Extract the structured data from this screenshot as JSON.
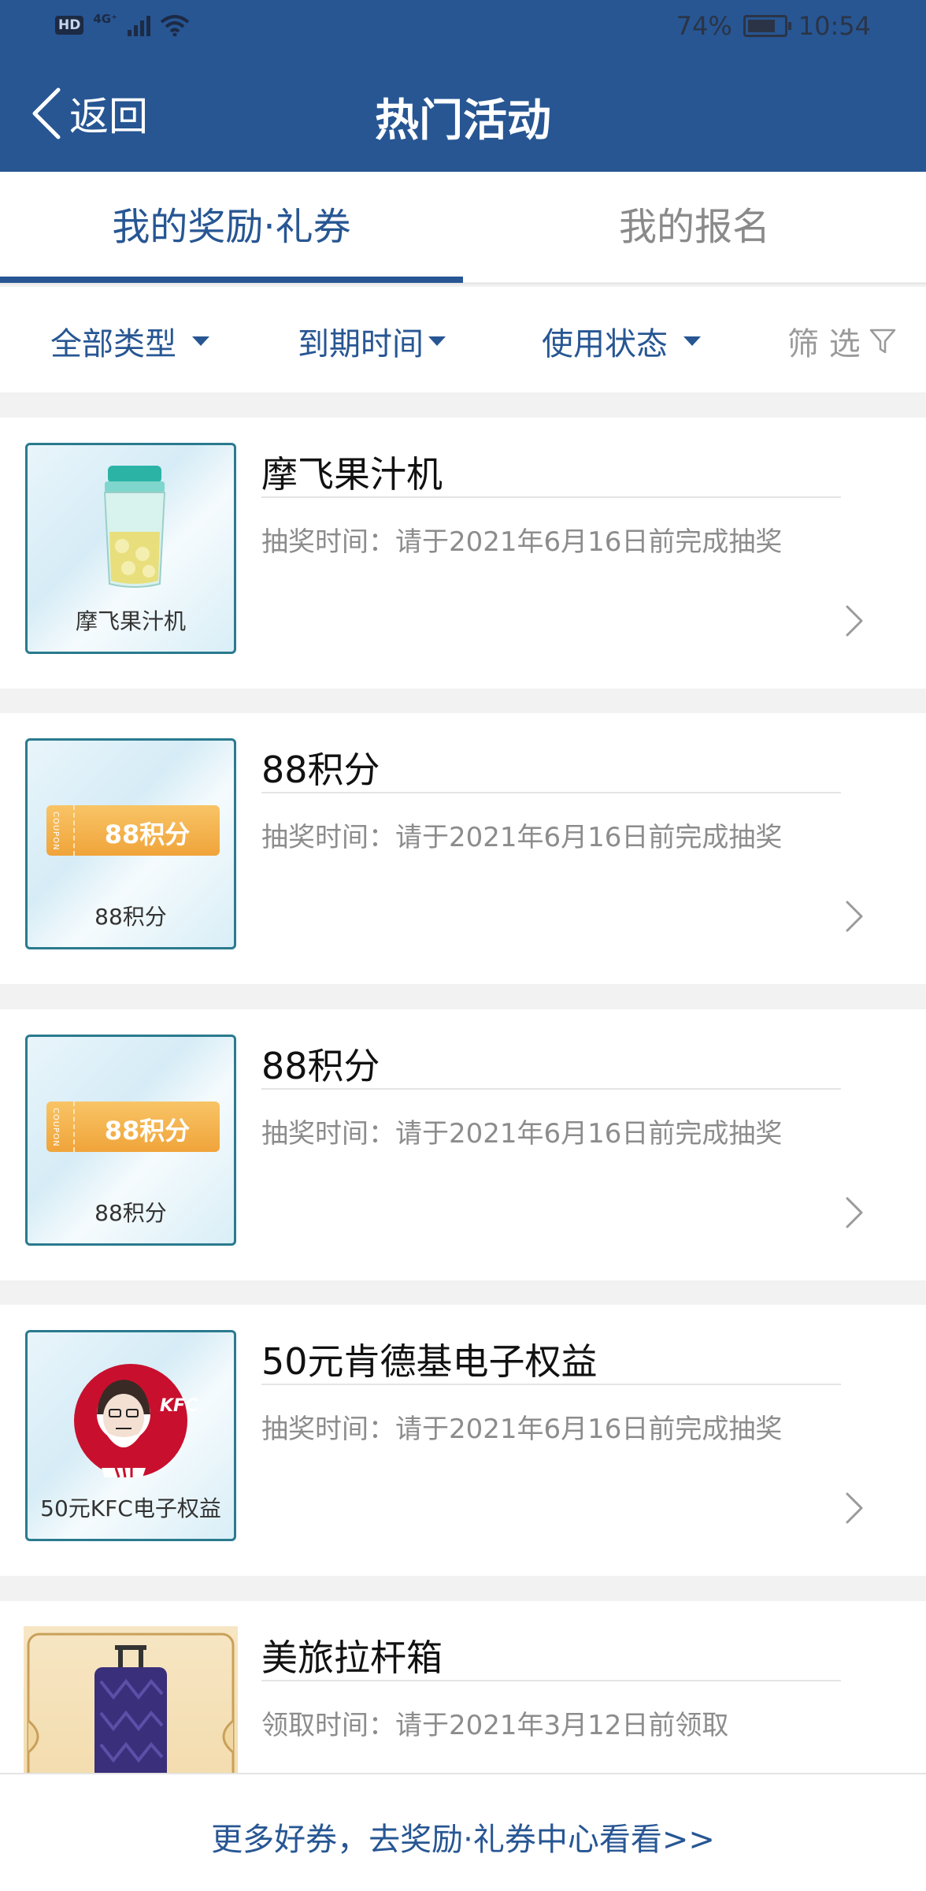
{
  "status_bar": {
    "hd": "HD",
    "network": "4G⁺",
    "battery_percent": "74%",
    "time": "10:54"
  },
  "header": {
    "back_label": "返回",
    "title": "热门活动"
  },
  "tabs": [
    {
      "label": "我的奖励·礼券",
      "active": true
    },
    {
      "label": "我的报名",
      "active": false
    }
  ],
  "filters": {
    "type": "全部类型",
    "expiry": "到期时间",
    "status": "使用状态",
    "screen": "筛 选"
  },
  "items": [
    {
      "title": "摩飞果汁机",
      "time": "抽奖时间：请于2021年6月16日前完成抽奖",
      "thumb_caption": "摩飞果汁机",
      "thumb_type": "juicer"
    },
    {
      "title": "88积分",
      "time": "抽奖时间：请于2021年6月16日前完成抽奖",
      "thumb_caption": "88积分",
      "thumb_type": "coupon",
      "coupon_text": "88积分",
      "coupon_stub": "COUPON"
    },
    {
      "title": "88积分",
      "time": "抽奖时间：请于2021年6月16日前完成抽奖",
      "thumb_caption": "88积分",
      "thumb_type": "coupon",
      "coupon_text": "88积分",
      "coupon_stub": "COUPON"
    },
    {
      "title": "50元肯德基电子权益",
      "time": "抽奖时间：请于2021年6月16日前完成抽奖",
      "thumb_caption": "50元KFC电子权益",
      "thumb_type": "kfc",
      "logo_text": "KFC"
    },
    {
      "title": "美旅拉杆箱",
      "time": "领取时间：请于2021年3月12日前领取",
      "thumb_type": "suitcase"
    }
  ],
  "bottom_link": "更多好券，去奖励·礼券中心看看>>",
  "colors": {
    "brand": "#275693",
    "coupon": "#f0a43a",
    "kfc_red": "#c8102e"
  }
}
